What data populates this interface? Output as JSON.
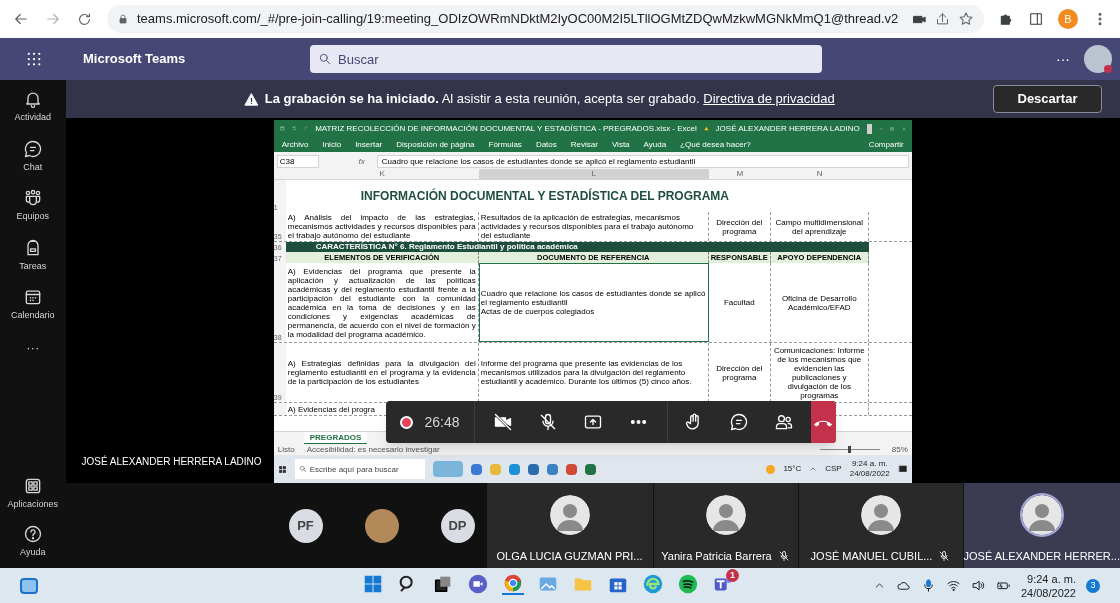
{
  "browser": {
    "url": "teams.microsoft.com/_#/pre-join-calling/19:meeting_ODIzOWRmNDktM2IyOC00M2I5LTllOGMtZDQwMzkwMGNkMmQ1@thread.v2",
    "profile_initial": "B"
  },
  "teams_header": {
    "app_name": "Microsoft Teams",
    "search": {
      "placeholder": "Buscar"
    },
    "more": "···"
  },
  "app_bar": {
    "items": [
      {
        "label": "Actividad",
        "kind": "bell"
      },
      {
        "label": "Chat",
        "kind": "chat"
      },
      {
        "label": "Equipos",
        "kind": "teams"
      },
      {
        "label": "Tareas",
        "kind": "backpack"
      },
      {
        "label": "Calendario",
        "kind": "calendar"
      }
    ],
    "more": "···",
    "bottom_items": [
      {
        "label": "Aplicaciones",
        "kind": "apps"
      },
      {
        "label": "Ayuda",
        "kind": "help"
      }
    ]
  },
  "banner": {
    "text": "**La grabación se ha iniciado.** Al asistir a esta reunión, acepta ser grabado.",
    "link": "Directiva de privacidad",
    "button": "Descartar"
  },
  "shared_screen": {
    "presenter": "JOSÉ ALEXANDER HERRERA LADINO",
    "excel": {
      "title": "MATRIZ RECOLECCIÓN DE INFORMACIÓN DOCUMENTAL Y ESTADÍSTICA - PREGRADOS.xlsx - Excel",
      "account": "JOSÉ ALEXANDER HERRERA LADINO",
      "ribbon_tabs": [
        "Archivo",
        "Inicio",
        "Insertar",
        "Disposición de página",
        "Fórmulas",
        "Datos",
        "Revisar",
        "Vista",
        "Ayuda"
      ],
      "tell_me": "¿Qué desea hacer?",
      "share": "Compartir",
      "name_box": "C38",
      "formula_symbol": "fx",
      "formula": "Cuadro que relacione los casos de estudiantes donde se aplicó el reglamento estudiantil",
      "columns": [
        "K",
        "L",
        "M",
        "N"
      ],
      "sheet_title": {
        "row": "1",
        "text": "INFORMACIÓN DOCUMENTAL Y ESTADÍSTICA DEL PROGRAMA"
      },
      "rows": [
        {
          "row": "35",
          "kind": "data",
          "cells": [
            {
              "text": "A) Análisis del impacto de las estrategias, mecanismos actividades y recursos disponibles para el trabajo autónomo del estudiante",
              "selected": false
            },
            {
              "text": "Resultados de la aplicación de estrategias, mecanismos actividades y recursos disponibles para el trabajo autónomo del estudiante",
              "selected": false
            },
            {
              "text": "Dirección del programa",
              "selected": false
            },
            {
              "text": "Campo multidimensional del aprendizaje",
              "selected": false
            }
          ]
        },
        {
          "row": "36",
          "kind": "band",
          "text": "CARACTERÍSTICA N° 6. Reglamento Estudiantil y política académica"
        },
        {
          "row": "37",
          "kind": "header",
          "cells": [
            "ELEMENTOS DE VERIFICACIÓN",
            "DOCUMENTO DE REFERENCIA",
            "RESPONSABLE",
            "APOYO DEPENDENCIA"
          ]
        },
        {
          "row": "38",
          "kind": "data",
          "cells": [
            {
              "text": "A) Evidencias del programa que presente la aplicación y actualización de las políticas académicas y del reglamento estudiantil frente a la participación del estudiante con la comunidad académica en la toma de decisiones y en las condiciones y exigencias académicas de permanencia, de acuerdo con el nivel de formación y la modalidad del programa académico.",
              "selected": false
            },
            {
              "text": "Cuadro que relacione los casos de estudiantes donde se aplicó el reglamento estudiantil\nActas de de cuerpos colegiados",
              "selected": true
            },
            {
              "text": "Facultad",
              "selected": false
            },
            {
              "text": "Oficina de Desarrollo Académico/EFAD",
              "selected": false
            }
          ]
        },
        {
          "row": "39",
          "kind": "data",
          "cells": [
            {
              "text": "A) Estrategias definidas para la divulgación del reglamento estudiantil en el programa y la evidencia de la participación de los estudiantes",
              "selected": false
            },
            {
              "text": "Informe del programa que presente las evidencias de los mecanismos utilizados para la divulgación del reglamento estudiantil y académico. Durante los últimos (5) cinco años.",
              "selected": false
            },
            {
              "text": "Dirección del programa",
              "selected": false
            },
            {
              "text": "Comunicaciones: Informe de los mecanismos que evidencien las publicaciones y divulgación de los programas",
              "selected": false
            }
          ]
        },
        {
          "kind": "data",
          "cells": [
            {
              "text": "A) Evidencias del progra",
              "selected": false
            }
          ]
        }
      ],
      "sheet_tab": {
        "label": "PREGRADOS",
        "selected": true
      },
      "status": {
        "ready": "Listo",
        "accessibility": "Accesibilidad: es necesario investigar",
        "zoom": "85%",
        "zoom_slider": {
          "level": 0.5
        }
      },
      "windows_taskbar": {
        "search_placeholder": "Escribe aquí para buscar",
        "weather": "15°C",
        "language": "CSP",
        "time": "9:24 a. m.",
        "date": "24/08/2022"
      }
    }
  },
  "call_controls": {
    "timer": "26:48",
    "recording": true,
    "camera_on": false,
    "mic_on": false
  },
  "participants": {
    "overflow": [
      {
        "kind": "initials",
        "initials": "PF"
      },
      {
        "kind": "photo"
      },
      {
        "kind": "initials",
        "initials": "DP"
      }
    ],
    "tiles": [
      {
        "name": "OLGA LUCIA GUZMAN PRI...",
        "muted": false,
        "speaking": false
      },
      {
        "name": "Yanira Patricia Barrera",
        "muted": true,
        "speaking": false
      },
      {
        "name": "JOSÉ MANUEL CUBIL...",
        "muted": true,
        "speaking": false
      },
      {
        "name": "JOSÉ ALEXANDER HERRER...",
        "muted": false,
        "speaking": true
      }
    ]
  },
  "taskbar": {
    "time": "9:24 a. m.",
    "date": "24/08/2022",
    "notification_count": "3",
    "teams_badge": "1"
  }
}
